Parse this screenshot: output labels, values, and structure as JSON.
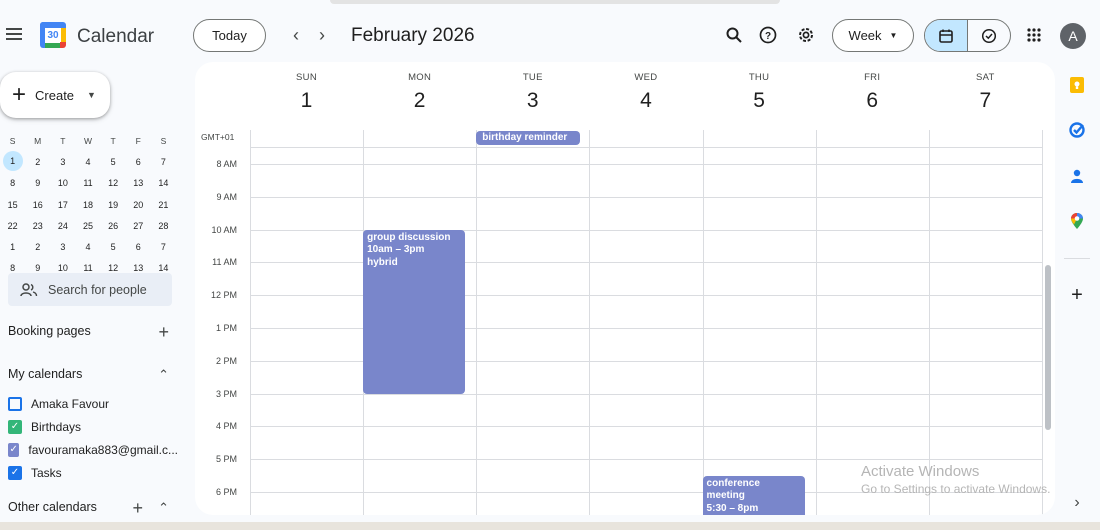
{
  "header": {
    "app_title": "Calendar",
    "logo_day": "30",
    "today_label": "Today",
    "period_label": "February 2026",
    "view_label": "Week",
    "avatar_letter": "A"
  },
  "sidebar": {
    "create_label": "Create",
    "mini_calendar": {
      "weekday_headers": [
        "S",
        "M",
        "T",
        "W",
        "T",
        "F",
        "S"
      ],
      "selected_day": "1",
      "weeks": [
        [
          "1",
          "2",
          "3",
          "4",
          "5",
          "6",
          "7"
        ],
        [
          "8",
          "9",
          "10",
          "11",
          "12",
          "13",
          "14"
        ],
        [
          "15",
          "16",
          "17",
          "18",
          "19",
          "20",
          "21"
        ],
        [
          "22",
          "23",
          "24",
          "25",
          "26",
          "27",
          "28"
        ],
        [
          "1",
          "2",
          "3",
          "4",
          "5",
          "6",
          "7"
        ],
        [
          "8",
          "9",
          "10",
          "11",
          "12",
          "13",
          "14"
        ]
      ]
    },
    "search_people_placeholder": "Search for people",
    "booking_pages_label": "Booking pages",
    "my_calendars_label": "My calendars",
    "my_calendars": [
      {
        "name": "Amaka Favour",
        "checked": false,
        "color": "#1a73e8"
      },
      {
        "name": "Birthdays",
        "checked": true,
        "color": "#33b679"
      },
      {
        "name": "favouramaka883@gmail.c...",
        "checked": true,
        "color": "#7986cb"
      },
      {
        "name": "Tasks",
        "checked": true,
        "color": "#1a73e8"
      }
    ],
    "other_calendars_label": "Other calendars"
  },
  "week": {
    "timezone_label": "GMT+01",
    "days": [
      {
        "name": "SUN",
        "date": "1"
      },
      {
        "name": "MON",
        "date": "2"
      },
      {
        "name": "TUE",
        "date": "3"
      },
      {
        "name": "WED",
        "date": "4"
      },
      {
        "name": "THU",
        "date": "5"
      },
      {
        "name": "FRI",
        "date": "6"
      },
      {
        "name": "SAT",
        "date": "7"
      }
    ],
    "hours": [
      "8 AM",
      "9 AM",
      "10 AM",
      "11 AM",
      "12 PM",
      "1 PM",
      "2 PM",
      "3 PM",
      "4 PM",
      "5 PM",
      "6 PM"
    ],
    "all_day_event": {
      "title": "birthday reminder",
      "day": "TUE"
    },
    "events": [
      {
        "title": "group discussion",
        "time": "10am – 3pm",
        "location": "hybrid",
        "day": "MON"
      },
      {
        "title": "conference meeting",
        "time": "5:30 – 8pm",
        "location": "",
        "day": "THU"
      }
    ]
  },
  "watermark": {
    "line1": "Activate Windows",
    "line2": "Go to Settings to activate Windows."
  },
  "colors": {
    "event": "#7986cb",
    "selected_view": "#c2e7ff",
    "keep": "#fbbc04",
    "tasks": "#1a73e8",
    "contacts": "#1a73e8",
    "maps": "#ea4335"
  },
  "icons": {
    "header": [
      "menu-icon",
      "search-icon",
      "help-icon",
      "settings-icon",
      "apps-grid-icon",
      "calendar-view-icon",
      "tasks-view-icon"
    ],
    "rail": [
      "keep-icon",
      "tasks-icon",
      "contacts-icon",
      "maps-icon",
      "add-icon",
      "chevron-right-icon"
    ]
  }
}
